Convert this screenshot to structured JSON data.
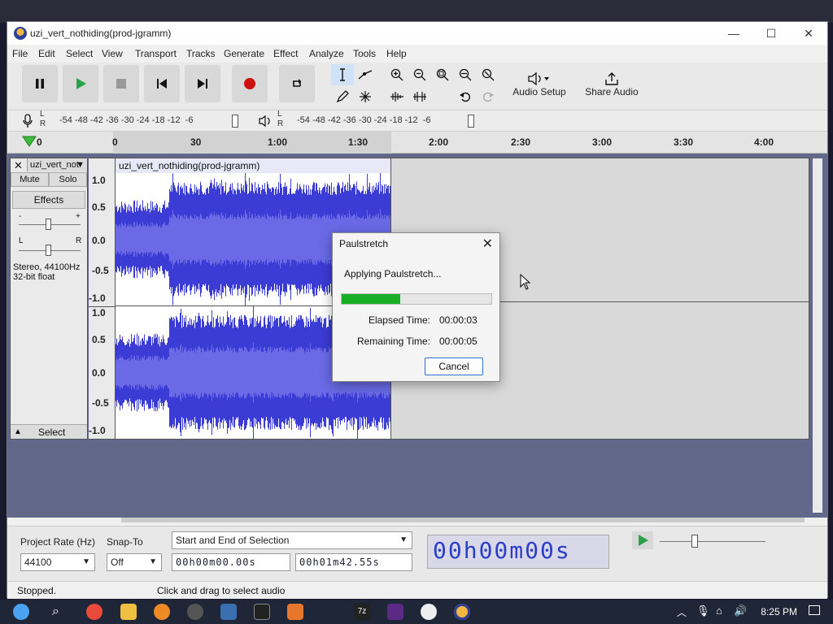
{
  "window": {
    "title": "uzi_vert_nothiding(prod-jgramm)",
    "minimize": "—",
    "maximize": "☐",
    "close": "✕"
  },
  "menu": [
    "File",
    "Edit",
    "Select",
    "View",
    "Transport",
    "Tracks",
    "Generate",
    "Effect",
    "Analyze",
    "Tools",
    "Help"
  ],
  "toolbar": {
    "audio_setup": "Audio Setup",
    "share_audio": "Share Audio"
  },
  "meters": {
    "rec_scale": "-54 -48 -42 -36 -30 -24 -18 -12  -6",
    "play_scale": "-54 -48 -42 -36 -30 -24 -18 -12  -6",
    "lr_top": "L",
    "lr_bottom": "R"
  },
  "ruler": {
    "ticks": [
      "0",
      "0",
      "30",
      "1:00",
      "1:30",
      "2:00",
      "2:30",
      "3:00",
      "3:30",
      "4:00"
    ]
  },
  "track": {
    "name": "uzi_vert_not",
    "mute": "Mute",
    "solo": "Solo",
    "effects": "Effects",
    "gain_minus": "-",
    "gain_plus": "+",
    "pan_l": "L",
    "pan_r": "R",
    "info_line1": "Stereo, 44100Hz",
    "info_line2": "32-bit float",
    "select": "Select",
    "clip_title": "uzi_vert_nothiding(prod-jgramm)",
    "scale_top": [
      "1.0",
      "0.5",
      "0.0",
      "-0.5",
      "-1.0"
    ],
    "scale_bottom": [
      "1.0",
      "0.5",
      "0.0",
      "-0.5",
      "-1.0"
    ]
  },
  "dialog": {
    "title": "Paulstretch",
    "message": "Applying Paulstretch...",
    "progress": 0.39,
    "elapsed_label": "Elapsed Time:",
    "elapsed_value": "00:00:03",
    "remaining_label": "Remaining Time:",
    "remaining_value": "00:00:05",
    "cancel": "Cancel"
  },
  "bottom": {
    "project_rate_label": "Project Rate (Hz)",
    "project_rate_value": "44100",
    "snap_label": "Snap-To",
    "snap_value": "Off",
    "selection_mode": "Start and End of Selection",
    "sel_start": "00h00m00.00s",
    "sel_end": "00h01m42.55s",
    "big_time": "00h00m00s"
  },
  "status": {
    "left": "Stopped.",
    "hint": "Click and drag to select audio"
  },
  "taskbar": {
    "clock": "8:25 PM"
  },
  "colors": {
    "wave": "#3b3bd6",
    "wave_rms": "#6a6ae6",
    "progress": "#1aad26",
    "record": "#cc1111",
    "play": "#2aa24a"
  }
}
